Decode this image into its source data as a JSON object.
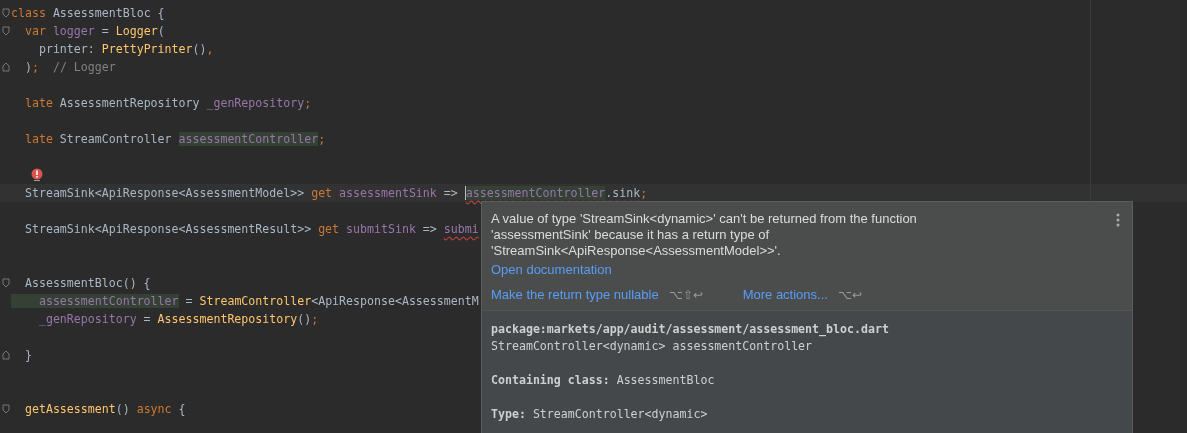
{
  "editor": {
    "lines": [
      {
        "kind": "code",
        "fold_start": true,
        "tokens": [
          {
            "kind": "keyword",
            "text": "class"
          },
          {
            "kind": "plain",
            "text": " AssessmentBloc {"
          }
        ]
      },
      {
        "kind": "code",
        "fold_start": true,
        "tokens": [
          {
            "kind": "keyword",
            "text": "  var"
          },
          {
            "kind": "field",
            "text": " logger"
          },
          {
            "kind": "plain",
            "text": " = "
          },
          {
            "kind": "call",
            "text": "Logger"
          },
          {
            "kind": "plain",
            "text": "("
          }
        ]
      },
      {
        "kind": "code",
        "tokens": [
          {
            "kind": "plain",
            "text": "    printer: "
          },
          {
            "kind": "call",
            "text": "PrettyPrinter"
          },
          {
            "kind": "plain",
            "text": "()"
          },
          {
            "kind": "keyword",
            "text": ","
          }
        ]
      },
      {
        "kind": "code",
        "fold_end": true,
        "tokens": [
          {
            "kind": "plain",
            "text": "  )"
          },
          {
            "kind": "keyword",
            "text": ";"
          },
          {
            "kind": "comment",
            "text": "  // Logger"
          }
        ]
      },
      {
        "kind": "blank"
      },
      {
        "kind": "code",
        "tokens": [
          {
            "kind": "keyword",
            "text": "  late"
          },
          {
            "kind": "plain",
            "text": " AssessmentRepository "
          },
          {
            "kind": "field",
            "text": "_genRepository"
          },
          {
            "kind": "keyword",
            "text": ";"
          }
        ]
      },
      {
        "kind": "blank"
      },
      {
        "kind": "code",
        "tokens": [
          {
            "kind": "keyword",
            "text": "  late"
          },
          {
            "kind": "plain",
            "text": " StreamController "
          },
          {
            "kind": "field",
            "text": "assessmentController",
            "highlight": true
          },
          {
            "kind": "keyword",
            "text": ";"
          }
        ]
      },
      {
        "kind": "blank"
      },
      {
        "kind": "error-marker"
      },
      {
        "kind": "code",
        "current": true,
        "tokens": [
          {
            "kind": "plain",
            "text": "  StreamSink<ApiResponse<AssessmentModel>> "
          },
          {
            "kind": "keyword",
            "text": "get"
          },
          {
            "kind": "field",
            "text": " assessmentSink"
          },
          {
            "kind": "plain",
            "text": " => "
          },
          {
            "kind": "field",
            "text": "assessmentController",
            "highlight": true,
            "error": true,
            "caret": true
          },
          {
            "kind": "plain",
            "text": ".sink",
            "error": true
          },
          {
            "kind": "keyword",
            "text": ";"
          }
        ]
      },
      {
        "kind": "blank"
      },
      {
        "kind": "code",
        "tokens": [
          {
            "kind": "plain",
            "text": "  StreamSink<ApiResponse<AssessmentResult>> "
          },
          {
            "kind": "keyword",
            "text": "get"
          },
          {
            "kind": "field",
            "text": " submitSink"
          },
          {
            "kind": "plain",
            "text": " => "
          },
          {
            "kind": "field",
            "text": "submi",
            "error": true
          }
        ]
      },
      {
        "kind": "blank"
      },
      {
        "kind": "blank"
      },
      {
        "kind": "code",
        "fold_start": true,
        "tokens": [
          {
            "kind": "plain",
            "text": "  AssessmentBloc() {"
          }
        ]
      },
      {
        "kind": "code",
        "tokens": [
          {
            "kind": "field",
            "text": "    assessmentController",
            "highlight": true
          },
          {
            "kind": "plain",
            "text": " = "
          },
          {
            "kind": "call",
            "text": "StreamController"
          },
          {
            "kind": "plain",
            "text": "<ApiResponse<AssessmentM"
          }
        ]
      },
      {
        "kind": "code",
        "tokens": [
          {
            "kind": "field",
            "text": "    _genRepository"
          },
          {
            "kind": "plain",
            "text": " = "
          },
          {
            "kind": "call",
            "text": "AssessmentRepository"
          },
          {
            "kind": "plain",
            "text": "()"
          },
          {
            "kind": "keyword",
            "text": ";"
          }
        ]
      },
      {
        "kind": "blank"
      },
      {
        "kind": "code",
        "fold_end": true,
        "tokens": [
          {
            "kind": "plain",
            "text": "  }"
          }
        ]
      },
      {
        "kind": "blank"
      },
      {
        "kind": "blank"
      },
      {
        "kind": "code",
        "fold_start": true,
        "tokens": [
          {
            "kind": "call",
            "text": "  getAssessment"
          },
          {
            "kind": "plain",
            "text": "() "
          },
          {
            "kind": "keyword",
            "text": "async"
          },
          {
            "kind": "plain",
            "text": " {"
          }
        ]
      }
    ]
  },
  "popup": {
    "message": "A value of type 'StreamSink<dynamic>' can't be returned from the function 'assessmentSink' because it has a return type of 'StreamSink<ApiResponse<AssessmentModel>>'.",
    "link": "Open documentation",
    "actions": [
      {
        "label": "Make the return type nullable",
        "shortcut": "⌥⇧↩"
      },
      {
        "label": "More actions...",
        "shortcut": "⌥↩"
      }
    ],
    "doc": {
      "path": "package:markets/app/audit/assessment/assessment_bloc.dart",
      "signature": "StreamController<dynamic> assessmentController",
      "details": [
        "**Containing class:** AssessmentBloc",
        "**Type:** StreamController<dynamic>"
      ]
    }
  }
}
